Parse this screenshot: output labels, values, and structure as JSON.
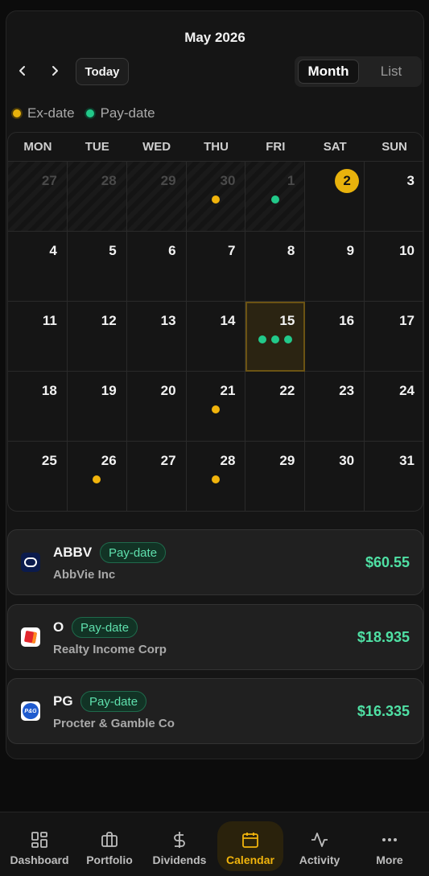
{
  "header": {
    "title": "May 2026",
    "today_label": "Today",
    "view_month": "Month",
    "view_list": "List"
  },
  "legend": {
    "ex": "Ex-date",
    "pay": "Pay-date"
  },
  "calendar": {
    "weekdays": [
      "MON",
      "TUE",
      "WED",
      "THU",
      "FRI",
      "SAT",
      "SUN"
    ],
    "days": [
      {
        "n": "27",
        "outside": true,
        "dots": []
      },
      {
        "n": "28",
        "outside": true,
        "dots": []
      },
      {
        "n": "29",
        "outside": true,
        "dots": []
      },
      {
        "n": "30",
        "outside": true,
        "dots": [
          "ex"
        ]
      },
      {
        "n": "1",
        "outside": true,
        "dots": [
          "pay"
        ]
      },
      {
        "n": "2",
        "today": true,
        "dots": []
      },
      {
        "n": "3",
        "dots": []
      },
      {
        "n": "4",
        "dots": []
      },
      {
        "n": "5",
        "dots": []
      },
      {
        "n": "6",
        "dots": []
      },
      {
        "n": "7",
        "dots": []
      },
      {
        "n": "8",
        "dots": []
      },
      {
        "n": "9",
        "dots": []
      },
      {
        "n": "10",
        "dots": []
      },
      {
        "n": "11",
        "dots": []
      },
      {
        "n": "12",
        "dots": []
      },
      {
        "n": "13",
        "dots": []
      },
      {
        "n": "14",
        "dots": []
      },
      {
        "n": "15",
        "selected": true,
        "dots": [
          "pay",
          "pay",
          "pay"
        ]
      },
      {
        "n": "16",
        "dots": []
      },
      {
        "n": "17",
        "dots": []
      },
      {
        "n": "18",
        "dots": []
      },
      {
        "n": "19",
        "dots": []
      },
      {
        "n": "20",
        "dots": []
      },
      {
        "n": "21",
        "dots": [
          "ex"
        ]
      },
      {
        "n": "22",
        "dots": []
      },
      {
        "n": "23",
        "dots": []
      },
      {
        "n": "24",
        "dots": []
      },
      {
        "n": "25",
        "dots": []
      },
      {
        "n": "26",
        "dots": [
          "ex"
        ]
      },
      {
        "n": "27",
        "dots": []
      },
      {
        "n": "28",
        "dots": [
          "ex"
        ]
      },
      {
        "n": "29",
        "dots": []
      },
      {
        "n": "30",
        "dots": []
      },
      {
        "n": "31",
        "dots": []
      }
    ]
  },
  "events": [
    {
      "ticker": "ABBV",
      "badge": "Pay-date",
      "company": "AbbVie Inc",
      "amount": "$60.55",
      "logo": "abbv"
    },
    {
      "ticker": "O",
      "badge": "Pay-date",
      "company": "Realty Income Corp",
      "amount": "$18.935",
      "logo": "o"
    },
    {
      "ticker": "PG",
      "badge": "Pay-date",
      "company": "Procter & Gamble Co",
      "amount": "$16.335",
      "logo": "pg"
    }
  ],
  "nav": [
    {
      "label": "Dashboard",
      "icon": "dashboard-icon"
    },
    {
      "label": "Portfolio",
      "icon": "briefcase-icon"
    },
    {
      "label": "Dividends",
      "icon": "dollar-icon"
    },
    {
      "label": "Calendar",
      "icon": "calendar-icon",
      "active": true
    },
    {
      "label": "Activity",
      "icon": "activity-icon"
    },
    {
      "label": "More",
      "icon": "more-icon"
    }
  ],
  "colors": {
    "accent": "#f1b40c",
    "pay": "#22c98a",
    "amount": "#4fe0a4"
  }
}
